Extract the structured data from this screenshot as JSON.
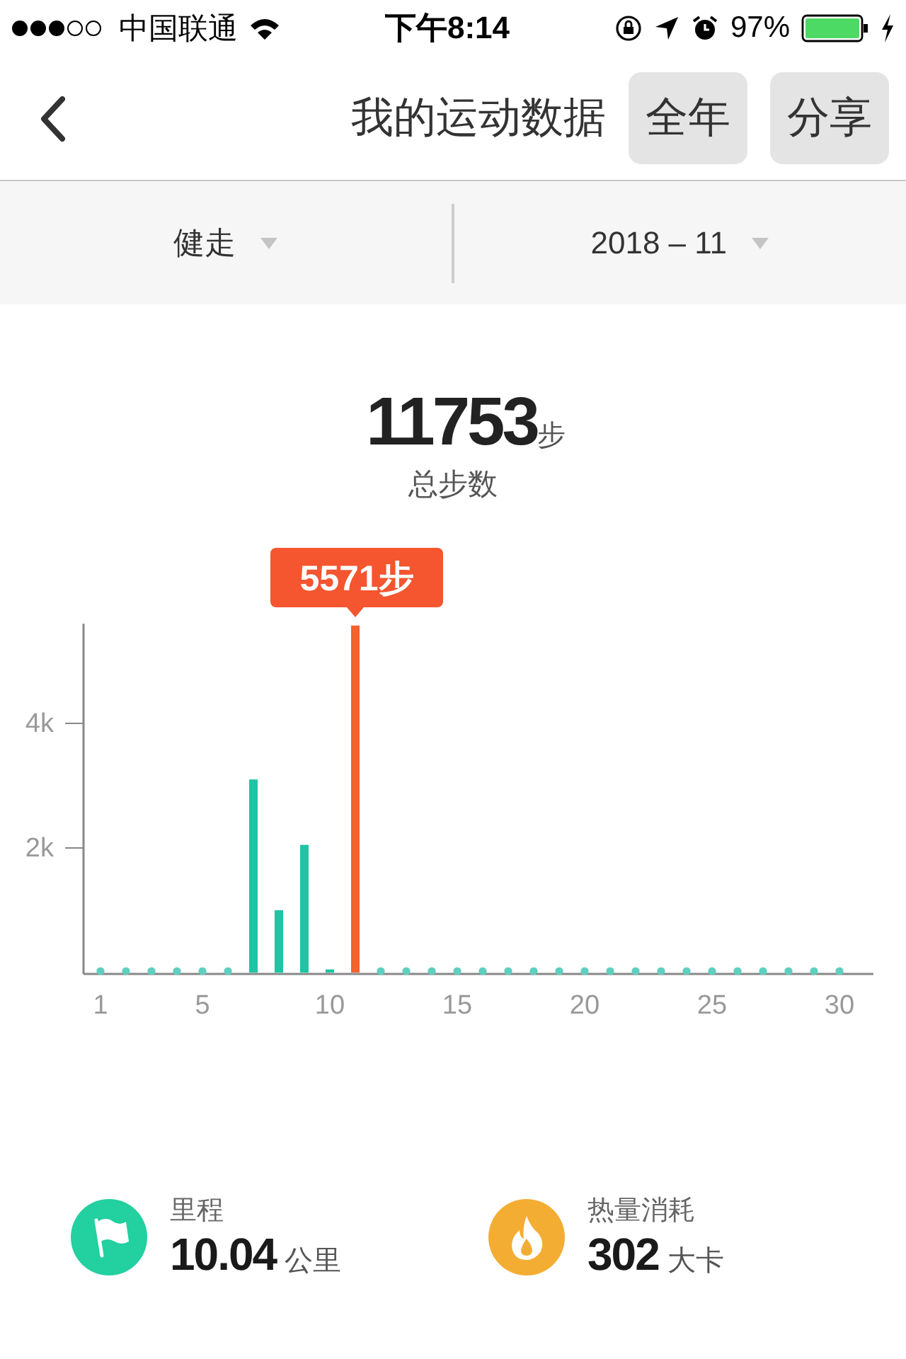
{
  "status_bar": {
    "carrier": "中国联通",
    "time": "下午8:14",
    "battery": "97%"
  },
  "nav": {
    "title": "我的运动数据",
    "buttons": [
      "全年",
      "分享"
    ]
  },
  "filters": [
    {
      "label": "健走"
    },
    {
      "label": "2018 – 11"
    }
  ],
  "total": {
    "value": "11753",
    "unit": "步",
    "label": "总步数"
  },
  "chart": {
    "chart_data": {
      "type": "bar",
      "x": [
        1,
        2,
        3,
        4,
        5,
        6,
        7,
        8,
        9,
        10,
        11,
        12,
        13,
        14,
        15,
        16,
        17,
        18,
        19,
        20,
        21,
        22,
        23,
        24,
        25,
        26,
        27,
        28,
        29,
        30
      ],
      "series": [
        {
          "color": "#1fc4a4",
          "values": [
            0,
            0,
            0,
            0,
            0,
            0,
            3100,
            1000,
            2050,
            50,
            null,
            0,
            0,
            0,
            0,
            0,
            0,
            0,
            0,
            0,
            0,
            0,
            0,
            0,
            0,
            0,
            0,
            0,
            0,
            0
          ]
        },
        {
          "color": "#f5622c",
          "values": [
            null,
            null,
            null,
            null,
            null,
            null,
            null,
            null,
            null,
            null,
            5571,
            null,
            null,
            null,
            null,
            null,
            null,
            null,
            null,
            null,
            null,
            null,
            null,
            null,
            null,
            null,
            null,
            null,
            null,
            null
          ]
        }
      ],
      "xlim": [
        0.33,
        31.33
      ],
      "xticks": [
        1,
        5,
        10,
        15,
        20,
        25,
        30
      ],
      "yticks": [
        {
          "value": 2000,
          "label": "2k"
        },
        {
          "value": 4000,
          "label": "4k"
        }
      ],
      "ylim": [
        0,
        5600
      ],
      "annotations": [
        "5571步"
      ]
    }
  },
  "stats": [
    {
      "kind": "distance",
      "label": "里程",
      "value": "10.04",
      "unit": "公里",
      "color": "#22d0a0"
    },
    {
      "kind": "calories",
      "label": "热量消耗",
      "value": "302",
      "unit": "大卡",
      "color": "#f4ad33"
    }
  ]
}
